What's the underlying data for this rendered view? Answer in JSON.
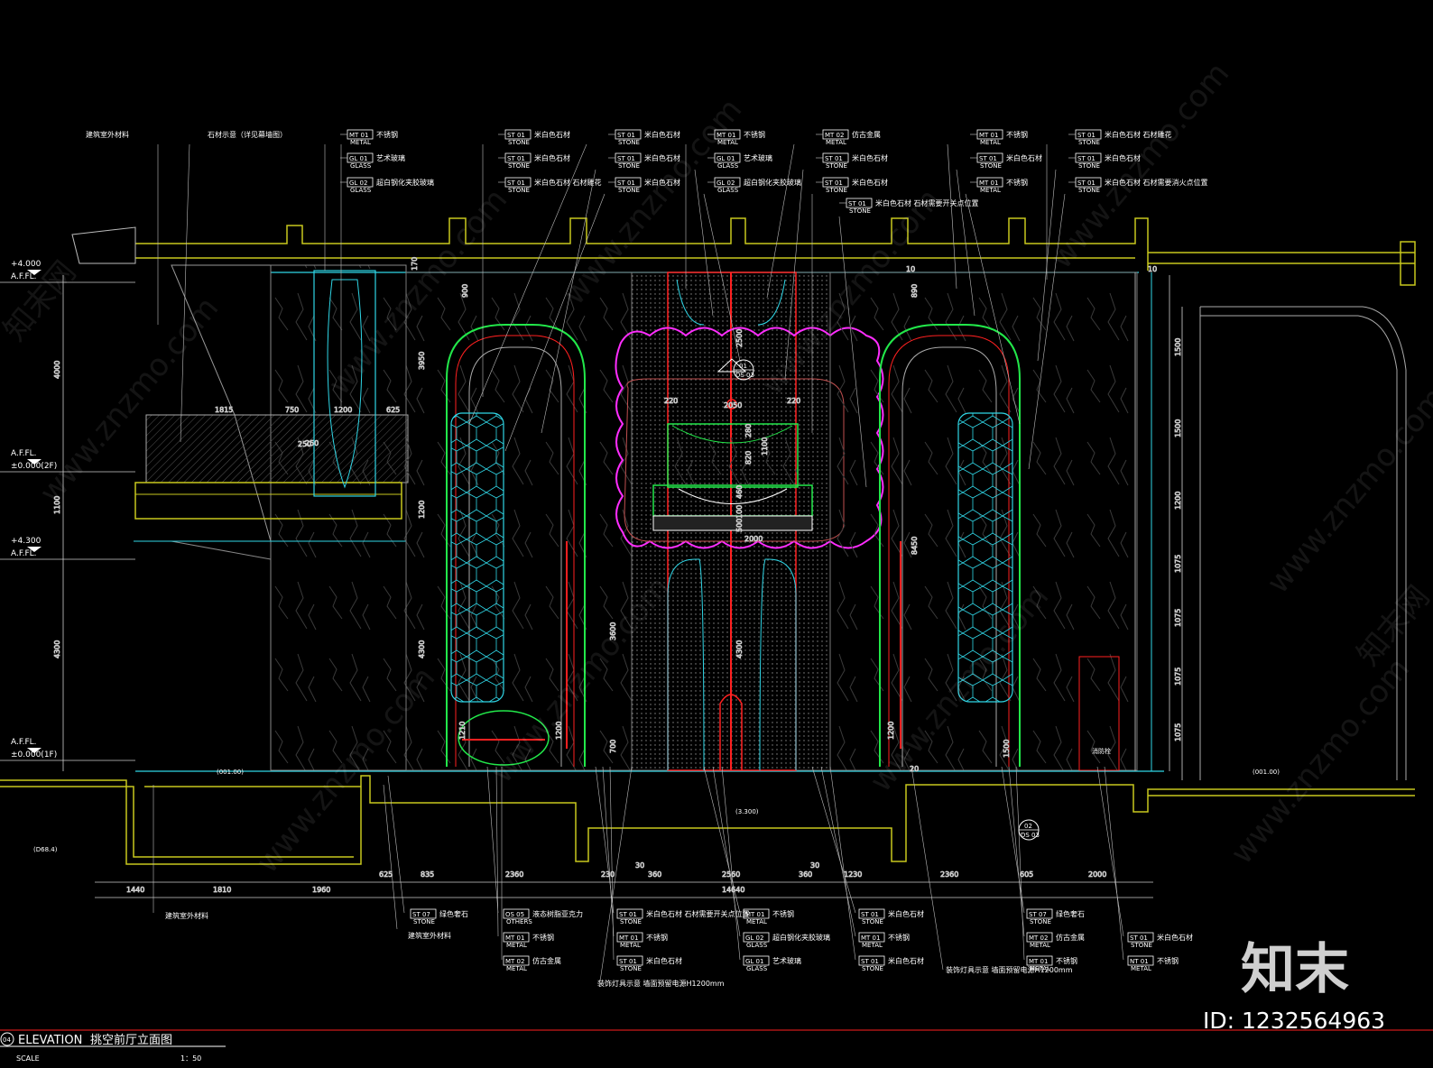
{
  "drawing": {
    "title_prefix": "ELEVATION",
    "title_cn": "挑空前厅立面图",
    "scale_label": "SCALE",
    "scale_value": "1：50",
    "sheet_no": "04"
  },
  "levels": [
    {
      "value": "+4.000",
      "sub": "A.F.FL."
    },
    {
      "value": "A.F.FL.",
      "sub": "±0.000(2F)"
    },
    {
      "value": "+4.300",
      "sub": "A.F.FL."
    },
    {
      "value": "A.F.FL.",
      "sub": "±0.000(1F)"
    }
  ],
  "top_callouts": [
    {
      "text": "建筑室外材料"
    },
    {
      "text": "石材示意（详见幕墙图）"
    },
    {
      "code": "MT 01",
      "cat": "METAL",
      "text": "不锈钢"
    },
    {
      "code": "GL 01",
      "cat": "GLASS",
      "text": "艺术玻璃"
    },
    {
      "code": "GL 02",
      "cat": "GLASS",
      "text": "超白钢化夹胶玻璃"
    },
    {
      "code": "ST 01",
      "cat": "STONE",
      "text": "米白色石材"
    },
    {
      "code": "ST 01",
      "cat": "STONE",
      "text": "米白色石材"
    },
    {
      "code": "ST 01",
      "cat": "STONE",
      "text": "米白色石材 石材雕花"
    },
    {
      "code": "ST 01",
      "cat": "STONE",
      "text": "米白色石材"
    },
    {
      "code": "ST 01",
      "cat": "STONE",
      "text": "米白色石材"
    },
    {
      "code": "ST 01",
      "cat": "STONE",
      "text": "米白色石材"
    },
    {
      "code": "MT 01",
      "cat": "METAL",
      "text": "不锈钢"
    },
    {
      "code": "GL 01",
      "cat": "GLASS",
      "text": "艺术玻璃"
    },
    {
      "code": "GL 02",
      "cat": "GLASS",
      "text": "超白钢化夹胶玻璃"
    },
    {
      "code": "MT 02",
      "cat": "METAL",
      "text": "仿古金属"
    },
    {
      "code": "ST 01",
      "cat": "STONE",
      "text": "米白色石材"
    },
    {
      "code": "ST 01",
      "cat": "STONE",
      "text": "米白色石材"
    },
    {
      "code": "ST 01",
      "cat": "STONE",
      "text": "米白色石材 石材需要开关点位置"
    },
    {
      "code": "MT 01",
      "cat": "METAL",
      "text": "不锈钢"
    },
    {
      "code": "ST 01",
      "cat": "STONE",
      "text": "米白色石材"
    },
    {
      "code": "MT 01",
      "cat": "METAL",
      "text": "不锈钢"
    },
    {
      "code": "ST 01",
      "cat": "STONE",
      "text": "米白色石材 石材雕花"
    },
    {
      "code": "ST 01",
      "cat": "STONE",
      "text": "米白色石材"
    },
    {
      "code": "ST 01",
      "cat": "STONE",
      "text": "米白色石材 石材需要消火点位置"
    }
  ],
  "bottom_callouts": [
    {
      "text": "建筑室外材料"
    },
    {
      "text": "建筑室外材料"
    },
    {
      "code": "ST 07",
      "cat": "STONE",
      "text": "绿色奢石"
    },
    {
      "code": "OS 05",
      "cat": "OTHERS",
      "text": "液态树脂亚克力"
    },
    {
      "code": "MT 01",
      "cat": "METAL",
      "text": "不锈钢"
    },
    {
      "code": "MT 02",
      "cat": "METAL",
      "text": "仿古金属"
    },
    {
      "code": "ST 01",
      "cat": "STONE",
      "text": "米白色石材 石材需要开关点位置"
    },
    {
      "code": "MT 01",
      "cat": "METAL",
      "text": "不锈钢"
    },
    {
      "code": "ST 01",
      "cat": "STONE",
      "text": "米白色石材"
    },
    {
      "text": "装饰灯具示意 墙面预留电源H1200mm"
    },
    {
      "code": "MT 01",
      "cat": "METAL",
      "text": "不锈钢"
    },
    {
      "code": "GL 02",
      "cat": "GLASS",
      "text": "超白钢化夹胶玻璃"
    },
    {
      "code": "GL 01",
      "cat": "GLASS",
      "text": "艺术玻璃"
    },
    {
      "code": "ST 01",
      "cat": "STONE",
      "text": "米白色石材"
    },
    {
      "code": "MT 01",
      "cat": "METAL",
      "text": "不锈钢"
    },
    {
      "code": "ST 01",
      "cat": "STONE",
      "text": "米白色石材"
    },
    {
      "text": "装饰灯具示意 墙面预留电源H1200mm"
    },
    {
      "code": "ST 07",
      "cat": "STONE",
      "text": "绿色奢石"
    },
    {
      "code": "MT 02",
      "cat": "METAL",
      "text": "仿古金属"
    },
    {
      "code": "MT 01",
      "cat": "METAL",
      "text": "不锈钢"
    },
    {
      "code": "ST 01",
      "cat": "STONE",
      "text": "米白色石材"
    },
    {
      "code": "NT 01",
      "cat": "METAL",
      "text": "不锈钢"
    }
  ],
  "dims_bottom": [
    "1440",
    "1810",
    "1960",
    "625",
    "835",
    "2360",
    "230",
    "30",
    "360",
    "2560",
    "360",
    "30",
    "1230",
    "2360",
    "605",
    "2000",
    "14640"
  ],
  "dims_left": [
    "4000",
    "1100",
    "4300"
  ],
  "dims_right": [
    "1500",
    "1500",
    "1200",
    "1075",
    "1075",
    "1075",
    "1075"
  ],
  "dims_inner": [
    "1815",
    "750",
    "1200",
    "625",
    "250",
    "3950",
    "1200",
    "4300",
    "2500",
    "2050",
    "220",
    "220",
    "280",
    "820",
    "1100",
    "460",
    "100",
    "500",
    "3600",
    "4300",
    "8450",
    "1200",
    "2000",
    "700",
    "900",
    "170",
    "10",
    "890",
    "10",
    "1500",
    "1200",
    "1210",
    "20",
    "250"
  ],
  "level_tags": [
    "(001.00)",
    "(001.00)",
    "(3.300)",
    "(D68.4)"
  ],
  "section_marks": [
    {
      "no": "01",
      "ref": "DS 03"
    },
    {
      "no": "02",
      "ref": "DS 03"
    }
  ],
  "notes": [
    "消防栓"
  ],
  "watermark": {
    "site": "www.znzmo.com",
    "cn": "知末网"
  },
  "brand": {
    "logo": "知末",
    "id": "ID: 1232564963"
  },
  "colors": {
    "background": "#000000",
    "structure": "#c8c81e",
    "cyan": "#2fd6e6",
    "green": "#22e84a",
    "red": "#ff2020",
    "magenta": "#ff2dff",
    "wall": "#7a7a7a"
  }
}
